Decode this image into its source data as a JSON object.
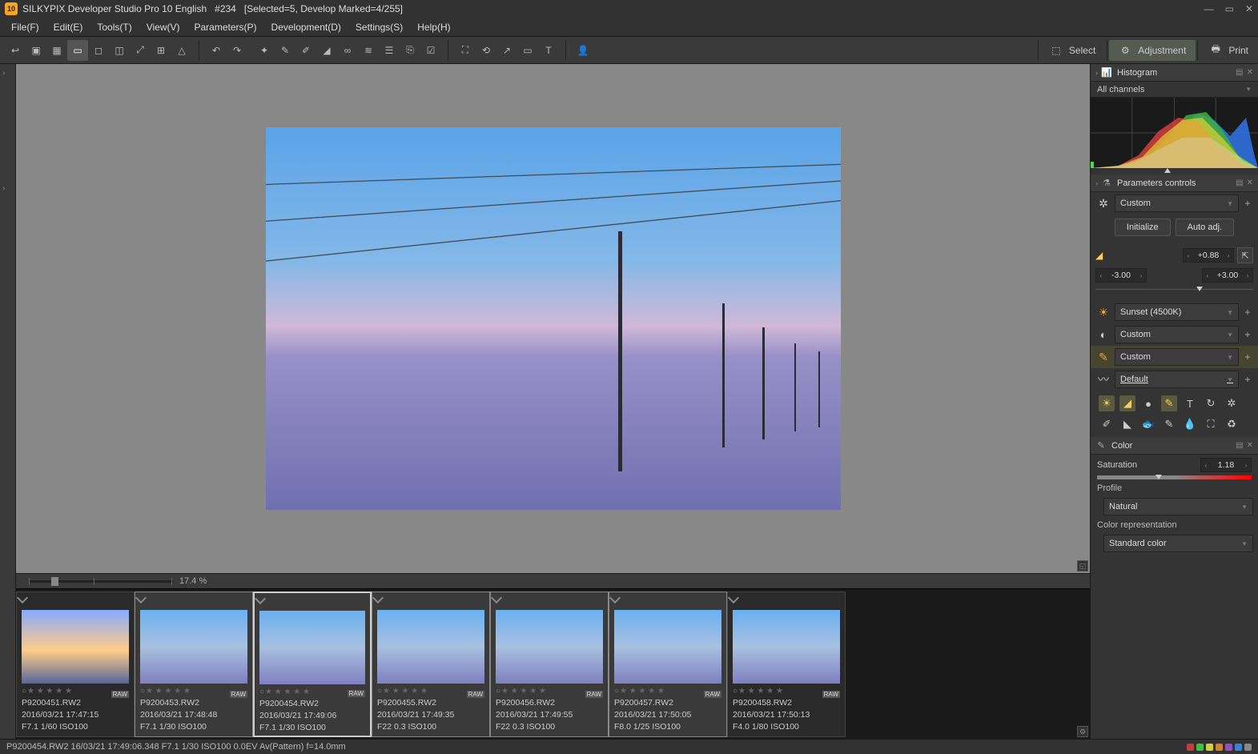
{
  "title_bar": {
    "app": "SILKYPIX Developer Studio Pro 10 English",
    "doc": "#234",
    "sel": "[Selected=5, Develop Marked=4/255]"
  },
  "menu": [
    "File(F)",
    "Edit(E)",
    "Tools(T)",
    "View(V)",
    "Parameters(P)",
    "Development(D)",
    "Settings(S)",
    "Help(H)"
  ],
  "toolbar_right": {
    "select": "Select",
    "adjust": "Adjustment",
    "print": "Print"
  },
  "zoom": {
    "value": "17.4",
    "unit": "%"
  },
  "thumbs": [
    {
      "file": "P9200451.RW2",
      "date": "2016/03/21 17:47:15",
      "exp": "F7.1 1/60 ISO100",
      "sunset": true,
      "sel": false
    },
    {
      "file": "P9200453.RW2",
      "date": "2016/03/21 17:48:48",
      "exp": "F7.1 1/30 ISO100",
      "sel": true
    },
    {
      "file": "P9200454.RW2",
      "date": "2016/03/21 17:49:06",
      "exp": "F7.1 1/30 ISO100",
      "sel": true,
      "active": true
    },
    {
      "file": "P9200455.RW2",
      "date": "2016/03/21 17:49:35",
      "exp": "F22 0.3 ISO100",
      "sel": true
    },
    {
      "file": "P9200456.RW2",
      "date": "2016/03/21 17:49:55",
      "exp": "F22 0.3 ISO100",
      "sel": true
    },
    {
      "file": "P9200457.RW2",
      "date": "2016/03/21 17:50:05",
      "exp": "F8.0 1/25 ISO100",
      "sel": true
    },
    {
      "file": "P9200458.RW2",
      "date": "2016/03/21 17:50:13",
      "exp": "F4.0 1/80 ISO100",
      "sel": false
    }
  ],
  "thumb_raw": "RAW",
  "panels": {
    "histogram": {
      "title": "Histogram",
      "mode": "All channels"
    },
    "params": {
      "title": "Parameters controls",
      "preset": "Custom",
      "init": "Initialize",
      "auto": "Auto adj.",
      "exp": "+0.88",
      "lo": "-3.00",
      "hi": "+3.00",
      "wb": "Sunset (4500K)",
      "tone": "Custom",
      "color_preset": "Custom",
      "nr": "Default"
    },
    "color": {
      "title": "Color",
      "sat_label": "Saturation",
      "sat_val": "1.18",
      "profile_label": "Profile",
      "profile": "Natural",
      "rep_label": "Color representation",
      "rep": "Standard color"
    }
  },
  "status": "P9200454.RW2 16/03/21 17:49:06.348 F7.1 1/30 ISO100  0.0EV Av(Pattern) f=14.0mm",
  "status_colors": [
    "#c04040",
    "#40c040",
    "#d0d040",
    "#d08030",
    "#9050c0",
    "#4080d0",
    "#888"
  ]
}
